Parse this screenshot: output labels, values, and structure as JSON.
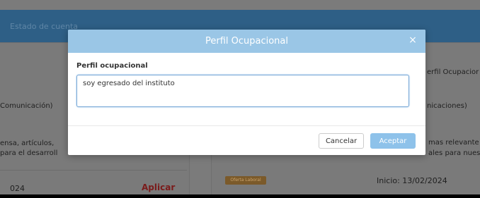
{
  "background": {
    "topbar_title": "Estado de cuenta",
    "left_card": {
      "label_comm": "Comunicación)",
      "text_line1": "ensa, artículos,",
      "text_line2": "para el desarroll",
      "date": "024",
      "apply_link": "Aplicar"
    },
    "right_card": {
      "header_text": "erfil Ocupacior",
      "label_comm": "nicaciones)",
      "text_line1": "mas relevante",
      "text_line2": "ales para nuest",
      "badge": "Oferta Laboral",
      "start_date": "Inicio: 13/02/2024"
    }
  },
  "modal": {
    "title": "Perfil Ocupacional",
    "close_symbol": "×",
    "field_label": "Perfil ocupacional",
    "field_value": "soy egresado del instituto",
    "cancel_label": "Cancelar",
    "accept_label": "Aceptar"
  },
  "colors": {
    "header": "#9ac6e6",
    "accept_button": "#8ec2ea",
    "overlay": "#7b7b7b"
  }
}
